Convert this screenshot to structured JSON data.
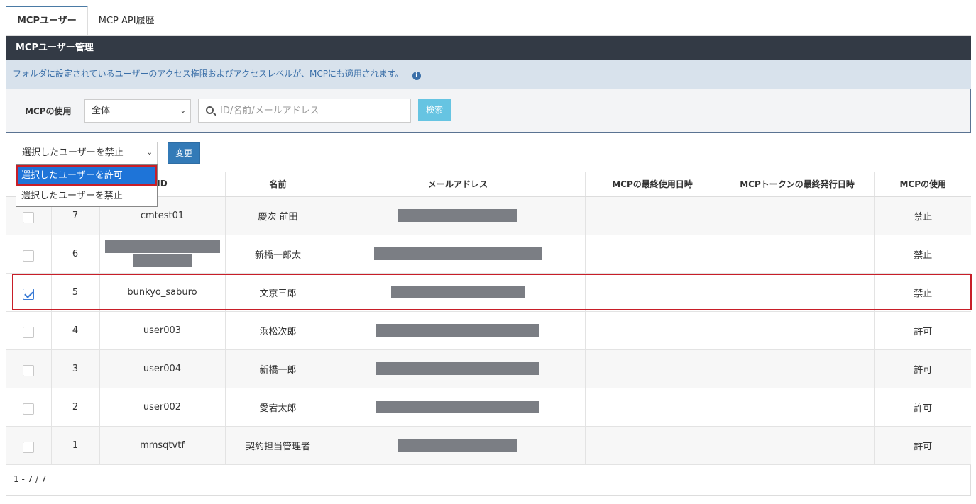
{
  "tabs": [
    {
      "label": "MCPユーザー"
    },
    {
      "label": "MCP API履歴"
    }
  ],
  "header": {
    "title": "MCPユーザー管理"
  },
  "info": {
    "text": "フォルダに設定されているユーザーのアクセス権限およびアクセスレベルが、MCPにも適用されます。",
    "icon": "info-icon"
  },
  "filter": {
    "label": "MCPの使用",
    "select_value": "全体",
    "search_placeholder": "ID/名前/メールアドレス",
    "search_button": "検索"
  },
  "bulk": {
    "select_value": "選択したユーザーを禁止",
    "change_button": "変更",
    "options": [
      "選択したユーザーを許可",
      "選択したユーザーを禁止"
    ]
  },
  "table": {
    "columns": [
      "",
      "",
      "ID",
      "名前",
      "メールアドレス",
      "MCPの最終使用日時",
      "MCPトークンの最終発行日時",
      "MCPの使用"
    ],
    "rows": [
      {
        "no": "7",
        "id": "cmtest01",
        "name": "慶次 前田",
        "checked": false,
        "status": "禁止"
      },
      {
        "no": "6",
        "id": "",
        "name": "新橋一郎太",
        "checked": false,
        "status": "禁止"
      },
      {
        "no": "5",
        "id": "bunkyo_saburo",
        "name": "文京三郎",
        "checked": true,
        "status": "禁止"
      },
      {
        "no": "4",
        "id": "user003",
        "name": "浜松次郎",
        "checked": false,
        "status": "許可"
      },
      {
        "no": "3",
        "id": "user004",
        "name": "新橋一郎",
        "checked": false,
        "status": "許可"
      },
      {
        "no": "2",
        "id": "user002",
        "name": "愛宕太郎",
        "checked": false,
        "status": "許可"
      },
      {
        "no": "1",
        "id": "mmsqtvtf",
        "name": "契約担当管理者",
        "checked": false,
        "status": "許可"
      }
    ]
  },
  "pagination": {
    "text": "1 - 7 / 7"
  },
  "colors": {
    "header_bg": "#333a45",
    "accent": "#337ab7",
    "search_btn": "#66c4e2",
    "highlight": "#c81e28"
  }
}
